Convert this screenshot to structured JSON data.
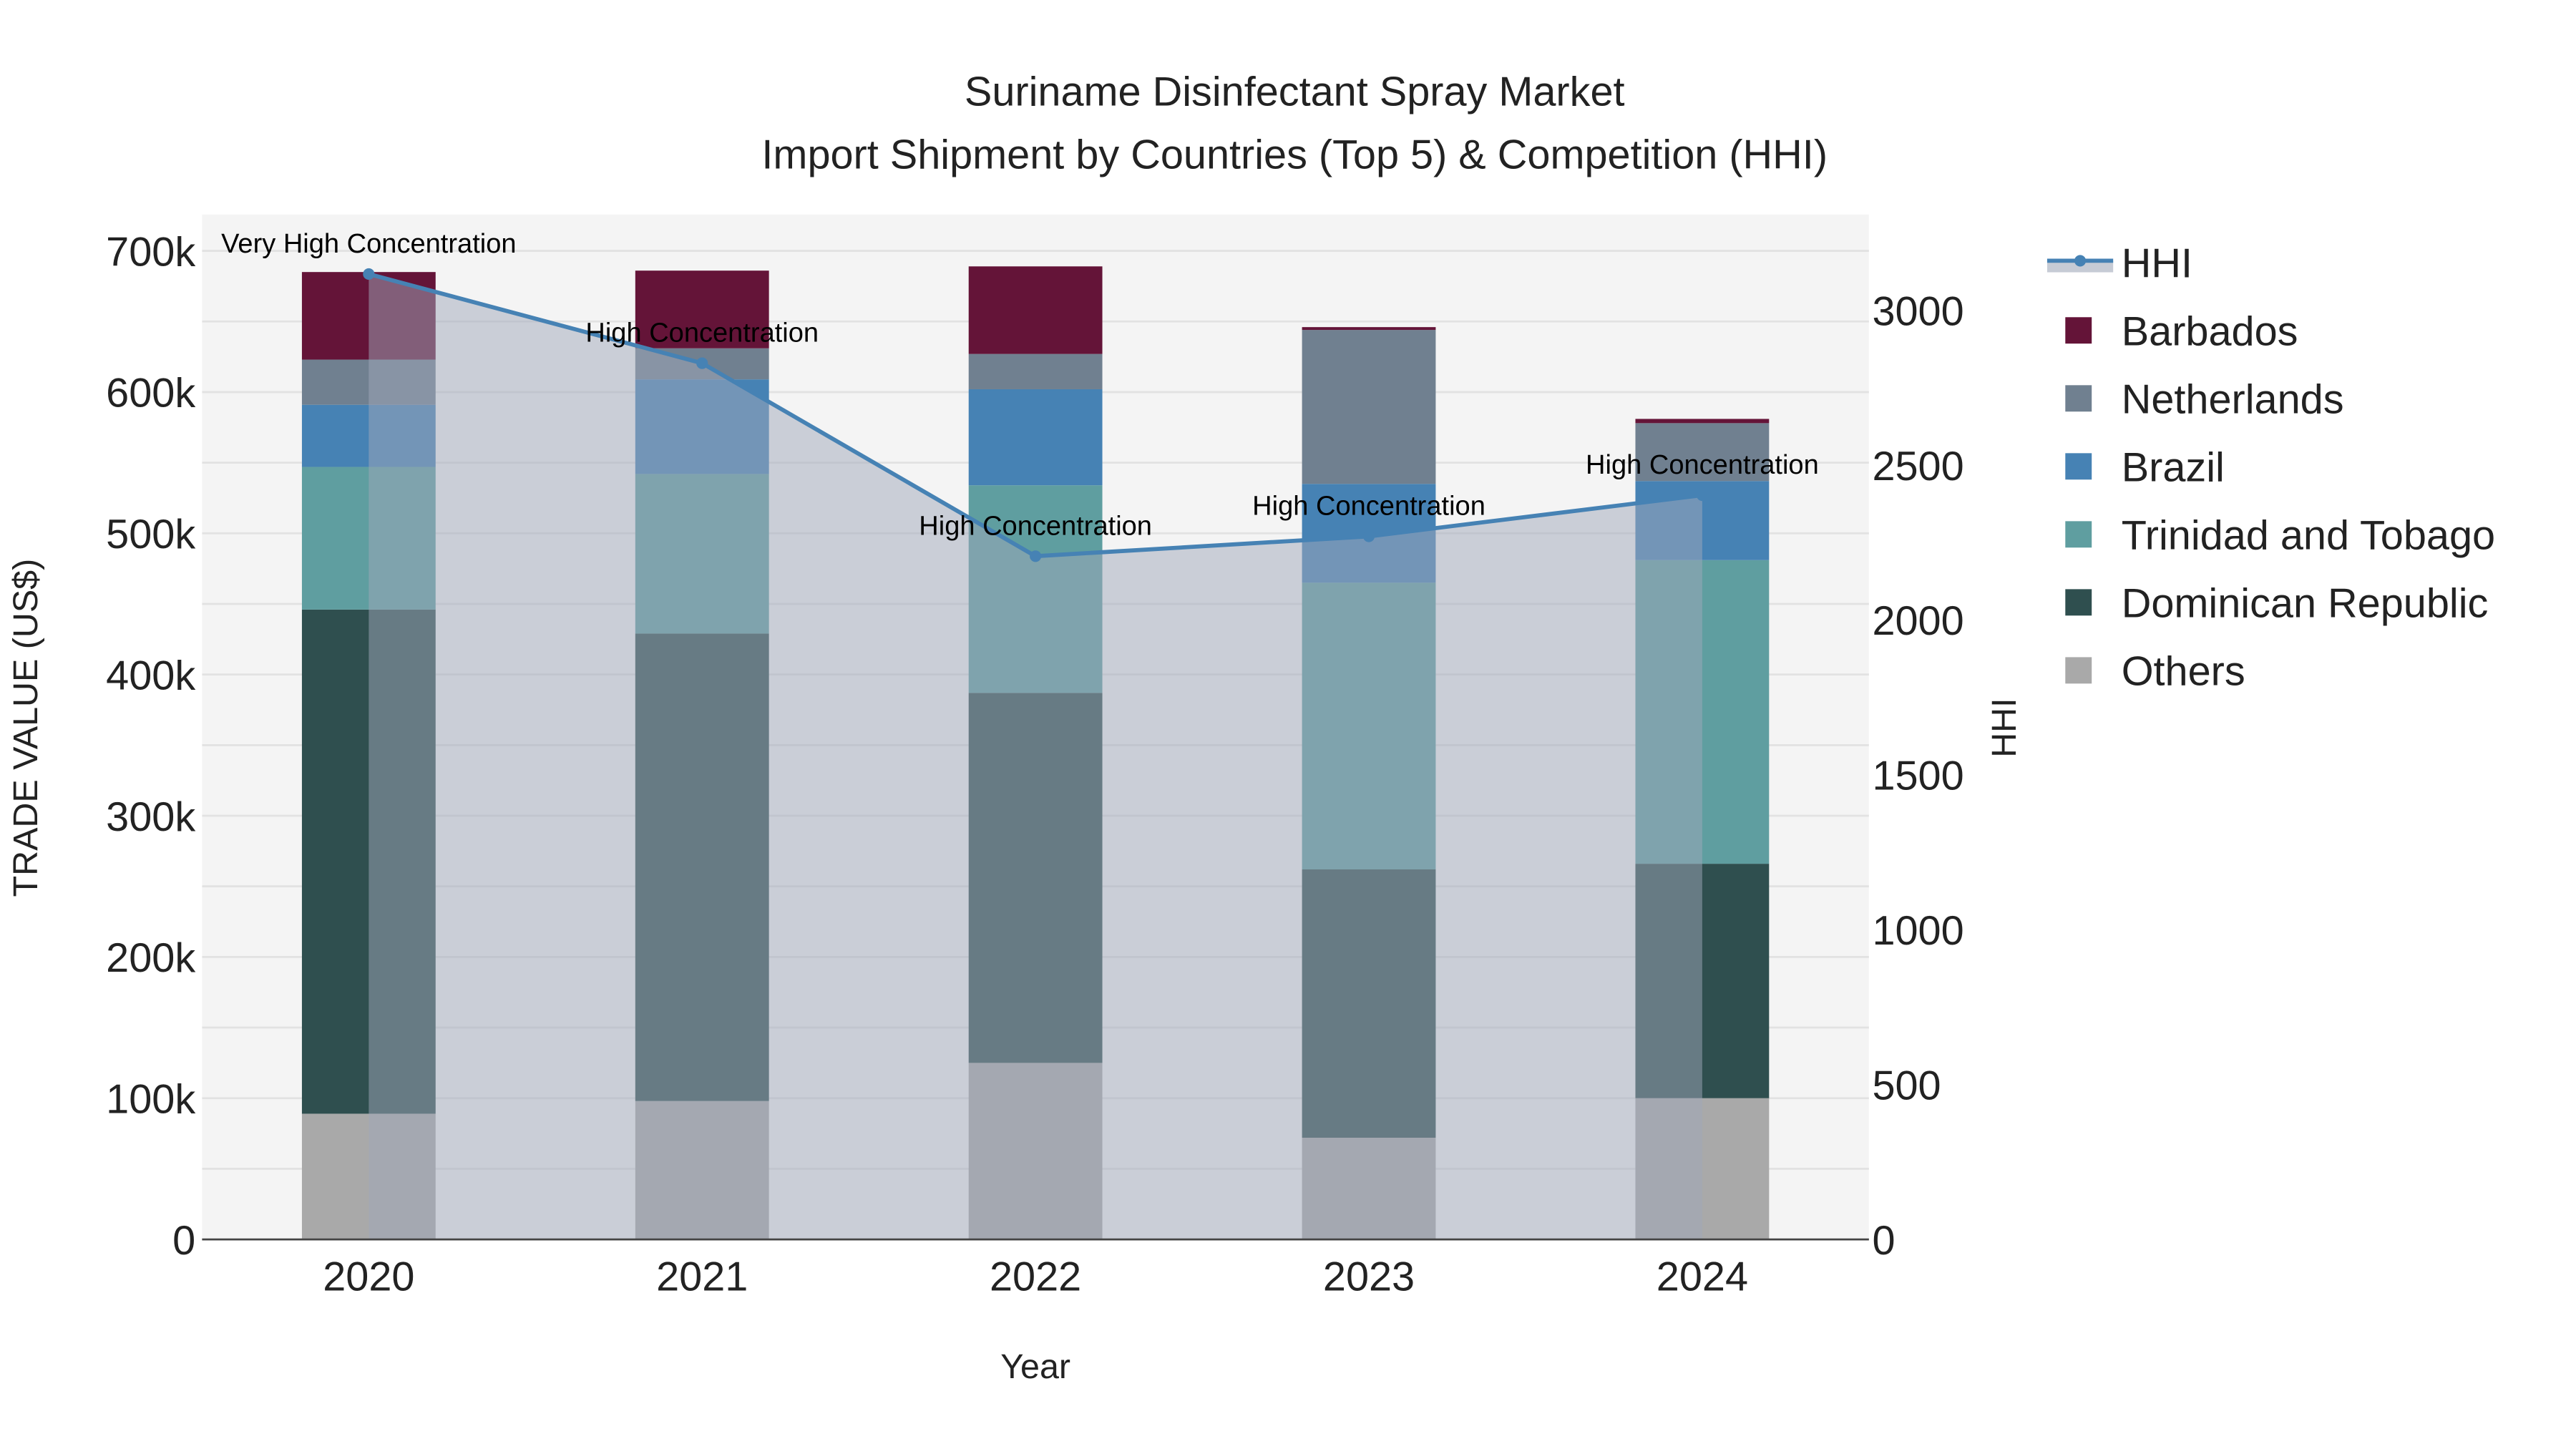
{
  "chart_data": {
    "type": "bar",
    "stacked": true,
    "title": "Suriname Disinfectant Spray Market",
    "subtitle": "Import Shipment by Countries (Top 5) & Competition (HHI)",
    "xlabel": "Year",
    "ylabel": "TRADE VALUE (US$)",
    "y2label": "HHI",
    "categories": [
      "2020",
      "2021",
      "2022",
      "2023",
      "2024"
    ],
    "ylim": [
      0,
      700000
    ],
    "y2lim": [
      0,
      3200
    ],
    "yticks": [
      "0",
      "100k",
      "200k",
      "300k",
      "400k",
      "500k",
      "600k",
      "700k"
    ],
    "y2ticks": [
      "0",
      "500",
      "1000",
      "1500",
      "2000",
      "2500",
      "3000"
    ],
    "series": [
      {
        "name": "Others",
        "color": "#a9a9a9",
        "values": [
          89000,
          98000,
          125000,
          72000,
          100000
        ]
      },
      {
        "name": "Dominican Republic",
        "color": "#2f4f4f",
        "values": [
          357000,
          331000,
          262000,
          190000,
          166000
        ]
      },
      {
        "name": "Trinidad and Tobago",
        "color": "#5f9ea0",
        "values": [
          101000,
          113000,
          147000,
          203000,
          215000
        ]
      },
      {
        "name": "Brazil",
        "color": "#4682b4",
        "values": [
          44000,
          67000,
          68000,
          70000,
          56000
        ]
      },
      {
        "name": "Netherlands",
        "color": "#708090",
        "values": [
          32000,
          22000,
          25000,
          109000,
          41000
        ]
      },
      {
        "name": "Barbados",
        "color": "#641438",
        "values": [
          62000,
          55000,
          62000,
          2000,
          3000
        ]
      }
    ],
    "hhi": {
      "name": "HHI",
      "color": "#4682b4",
      "values": [
        3117,
        2829,
        2206,
        2270,
        2403
      ],
      "annotations": [
        "Very High Concentration",
        "High Concentration",
        "High Concentration",
        "High Concentration",
        "High Concentration"
      ]
    },
    "legend_order": [
      "HHI",
      "Barbados",
      "Netherlands",
      "Brazil",
      "Trinidad and Tobago",
      "Dominican Republic",
      "Others"
    ],
    "legend_position": "right",
    "grid": true
  }
}
